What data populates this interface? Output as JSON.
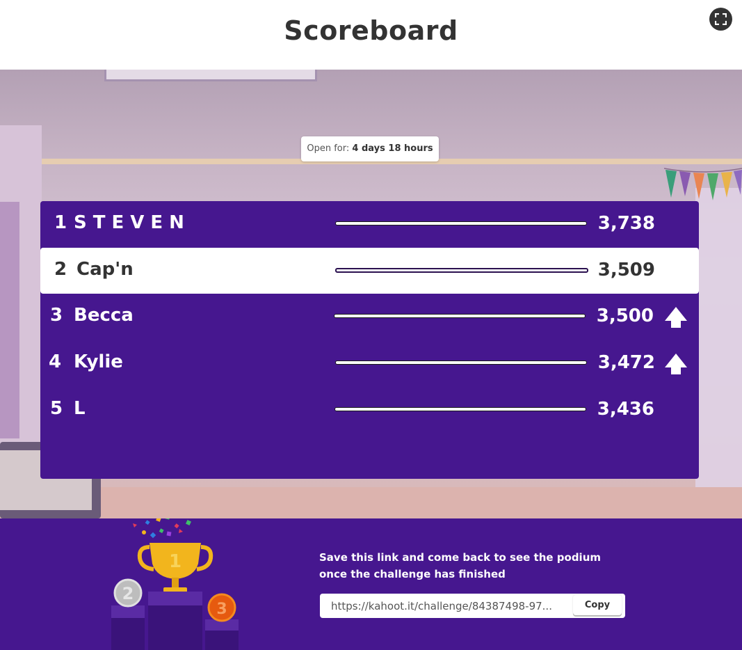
{
  "header": {
    "title": "Scoreboard",
    "fullscreen_icon": "fullscreen-icon"
  },
  "timer": {
    "label": "Open for:",
    "value": "4 days 18 hours"
  },
  "scoreboard": {
    "rows": [
      {
        "rank": "1",
        "name": "STEVEN",
        "score": "3,738",
        "trend": "none",
        "highlighted": false
      },
      {
        "rank": "2",
        "name": "Cap'n",
        "score": "3,509",
        "trend": "none",
        "highlighted": true
      },
      {
        "rank": "3",
        "name": "Becca",
        "score": "3,500",
        "trend": "up",
        "highlighted": false
      },
      {
        "rank": "4",
        "name": "Kylie",
        "score": "3,472",
        "trend": "up",
        "highlighted": false
      },
      {
        "rank": "5",
        "name": "L",
        "score": "3,436",
        "trend": "none",
        "highlighted": false
      }
    ]
  },
  "footer": {
    "message": "Save this link and come back to see the podium once the challenge has finished",
    "link": "https://kahoot.it/challenge/84387498-97...",
    "copy_label": "Copy",
    "podium_icon": "trophy-podium-icon",
    "podium_labels": {
      "first": "1",
      "second": "2",
      "third": "3"
    }
  },
  "colors": {
    "brand_purple": "#46178f",
    "header_bg": "#ffffff",
    "title_text": "#333333",
    "highlight_row": "#ffffff",
    "trophy_gold": "#f2b51d"
  }
}
